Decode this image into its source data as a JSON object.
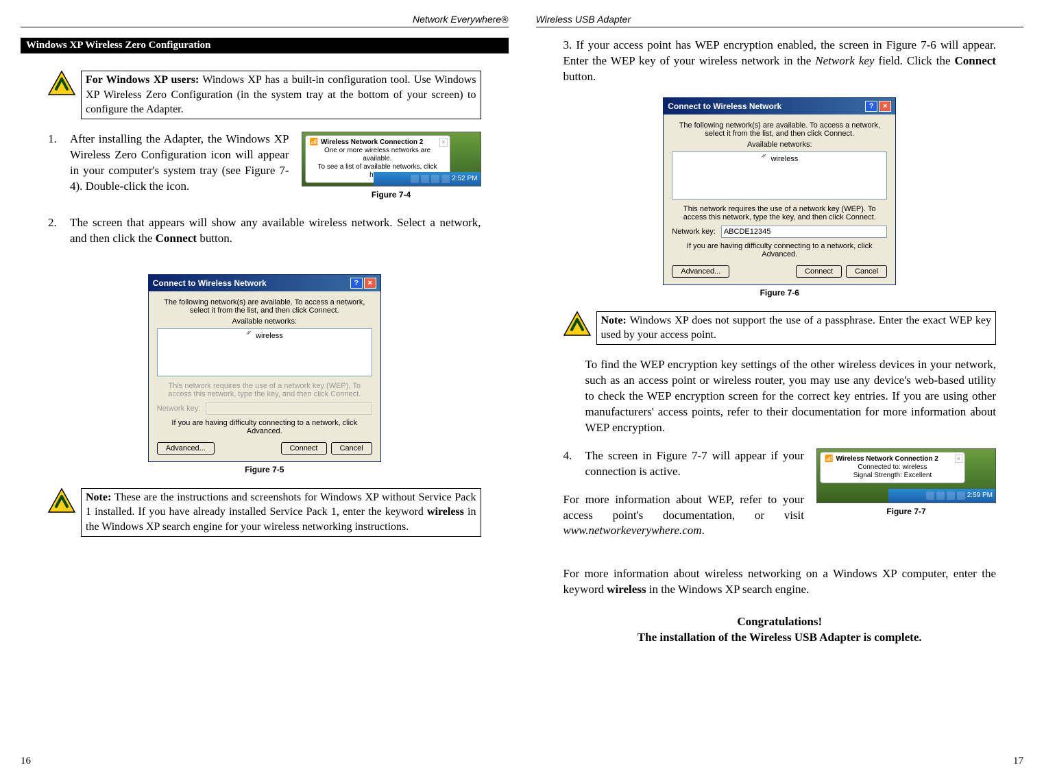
{
  "leftPage": {
    "header": "Network Everywhere®",
    "pageNumber": "16",
    "sectionTitle": "Windows XP Wireless Zero Configuration",
    "warn1_bold": "For Windows XP users:",
    "warn1_rest": " Windows XP has a built-in configuration tool. Use Windows XP Wireless Zero Configuration (in the system tray at the bottom of your screen) to configure the Adapter.",
    "step1_num": "1.",
    "step1_text": "After installing the Adapter, the Windows XP Wireless Zero Configuration icon will appear in your computer's system tray (see Figure 7-4). Double-click the icon.",
    "fig74_caption": "Figure 7-4",
    "systray74": {
      "title": "Wireless Network Connection 2",
      "line1": "One or more wireless networks are available.",
      "line2": "To see a list of available networks, click here.",
      "time": "2:52 PM"
    },
    "step2_num": "2.",
    "step2_a": "The screen that appears will show any available wireless network.  Select a network, and then click the ",
    "step2_bold": "Connect",
    "step2_b": " button.",
    "dialog75": {
      "title": "Connect to Wireless Network",
      "intro": "The following network(s) are available. To access a network, select it from the list, and then click Connect.",
      "availLabel": "Available networks:",
      "item": "wireless",
      "wepNote": "This network requires the use of a network key (WEP). To access this network, type the key, and then click Connect.",
      "keyLabel": "Network key:",
      "keyValue": "",
      "advNote": "If you are having difficulty connecting to a network, click Advanced.",
      "btnAdvanced": "Advanced...",
      "btnConnect": "Connect",
      "btnCancel": "Cancel"
    },
    "fig75_caption": "Figure 7-5",
    "warn2_bold": "Note:",
    "warn2_a": " These are the instructions and screenshots for Windows XP without Service Pack 1 installed. If you have already installed Service Pack 1, enter the keyword ",
    "warn2_kw": "wireless",
    "warn2_b": " in the Windows XP search engine for your wireless networking instructions."
  },
  "rightPage": {
    "header": "Wireless USB Adapter",
    "pageNumber": "17",
    "step3_a": "3. If your access point has WEP encryption enabled, the screen in Figure 7-6 will appear. Enter the WEP key of your wireless network in the ",
    "step3_italic": "Network key",
    "step3_b": " field. Click the ",
    "step3_bold": "Connect",
    "step3_c": " button.",
    "dialog76": {
      "title": "Connect to Wireless Network",
      "intro": "The following network(s) are available. To access a network, select it from the list, and then click Connect.",
      "availLabel": "Available networks:",
      "item": "wireless",
      "wepNote": "This network requires the use of a network key (WEP). To access this network, type the key, and then click Connect.",
      "keyLabel": "Network key:",
      "keyValue": "ABCDE12345",
      "advNote": "If you are having difficulty connecting to a network, click Advanced.",
      "btnAdvanced": "Advanced...",
      "btnConnect": "Connect",
      "btnCancel": "Cancel"
    },
    "fig76_caption": "Figure 7-6",
    "warn3_bold": "Note:",
    "warn3_rest": " Windows XP does not support the use of a passphrase. Enter the exact WEP key used by your access point.",
    "wep_para": "To find the WEP encryption key settings of the other wireless devices in your network, such as an access point or wireless router, you may use any device's web-based utility to check the WEP encryption screen for the correct key entries.  If you are using other manufacturers' access points, refer to their documentation for more information about WEP encryption.",
    "step4_num": "4.",
    "step4_text": "The screen in Figure 7-7 will appear if your connection is active.",
    "systray77": {
      "title": "Wireless Network Connection 2",
      "line1": "Connected to: wireless",
      "line2": "Signal Strength: Excellent",
      "time": "2:59 PM"
    },
    "fig77_caption": "Figure 7-7",
    "more1_a": "For more information about WEP, refer to your access point's documentation, or visit ",
    "more1_link": "www.networkeverywhere.com",
    "more1_b": ".",
    "more2_a": "For more information about wireless networking on a Windows XP computer, enter the keyword ",
    "more2_kw": "wireless",
    "more2_b": " in the Windows XP search engine.",
    "congrats1": "Congratulations!",
    "congrats2": "The installation of the Wireless USB Adapter is complete."
  }
}
